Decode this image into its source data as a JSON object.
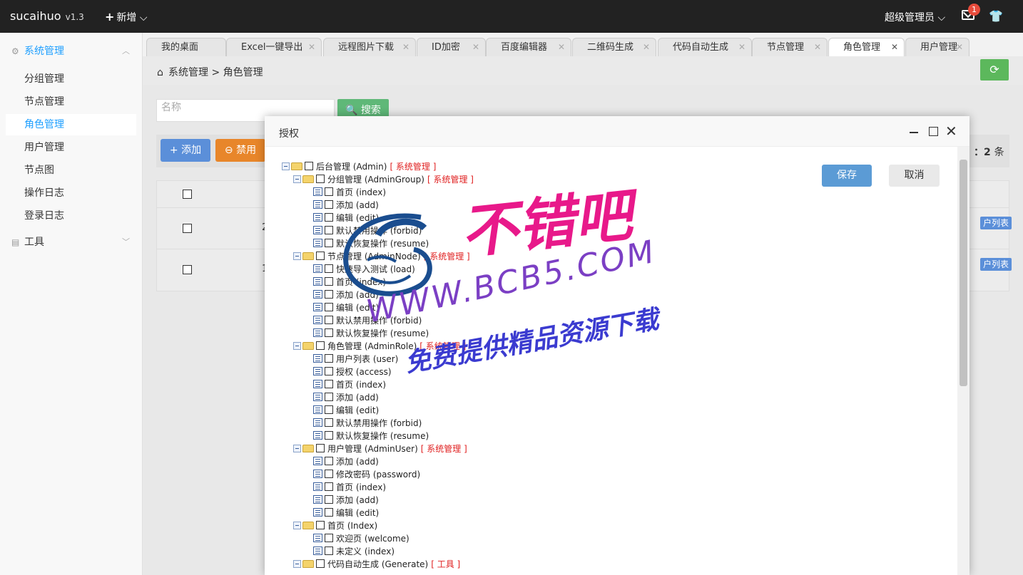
{
  "app": {
    "brand": "sucaihuo",
    "version": "v1.3",
    "new_label": "新增",
    "admin_label": "超级管理员",
    "mail_count": "1"
  },
  "sidebar": {
    "group1": "系统管理",
    "items": [
      "分组管理",
      "节点管理",
      "角色管理",
      "用户管理",
      "节点图",
      "操作日志",
      "登录日志"
    ],
    "active_index": 2,
    "group2": "工具"
  },
  "tabs": [
    {
      "label": "我的桌面",
      "closable": false
    },
    {
      "label": "Excel一键导出",
      "closable": true
    },
    {
      "label": "远程图片下载",
      "closable": true
    },
    {
      "label": "ID加密",
      "closable": true
    },
    {
      "label": "百度编辑器",
      "closable": true
    },
    {
      "label": "二维码生成",
      "closable": true
    },
    {
      "label": "代码自动生成",
      "closable": true
    },
    {
      "label": "节点管理",
      "closable": true
    },
    {
      "label": "角色管理",
      "closable": true,
      "active": true
    },
    {
      "label": "用户管理",
      "closable": true
    }
  ],
  "breadcrumb": {
    "root": "系统管理",
    "sep": ">",
    "current": "角色管理"
  },
  "search": {
    "placeholder": "名称",
    "button": "搜索"
  },
  "toolbar": {
    "add": "添加",
    "ban": "禁用",
    "total_prefix": "：",
    "total_count": "2",
    "total_suffix": "条"
  },
  "table": {
    "rows": [
      {
        "id": "2",
        "action": "户列表"
      },
      {
        "id": "1",
        "action": "户列表"
      }
    ]
  },
  "modal": {
    "title": "授权",
    "save": "保存",
    "cancel": "取消",
    "tree": [
      {
        "level": 0,
        "type": "folder",
        "label": "后台管理 (Admin)",
        "tag": "[ 系统管理 ]"
      },
      {
        "level": 1,
        "type": "folder",
        "label": "分组管理 (AdminGroup)",
        "tag": "[ 系统管理 ]"
      },
      {
        "level": 2,
        "type": "leaf",
        "label": "首页 (index)"
      },
      {
        "level": 2,
        "type": "leaf",
        "label": "添加 (add)"
      },
      {
        "level": 2,
        "type": "leaf",
        "label": "编辑 (edit)"
      },
      {
        "level": 2,
        "type": "leaf",
        "label": "默认禁用操作 (forbid)"
      },
      {
        "level": 2,
        "type": "leaf",
        "label": "默认恢复操作 (resume)"
      },
      {
        "level": 1,
        "type": "folder",
        "label": "节点管理 (AdminNode)",
        "tag": "[ 系统管理 ]"
      },
      {
        "level": 2,
        "type": "leaf",
        "label": "快速导入测试 (load)"
      },
      {
        "level": 2,
        "type": "leaf",
        "label": "首页 (index)"
      },
      {
        "level": 2,
        "type": "leaf",
        "label": "添加 (add)"
      },
      {
        "level": 2,
        "type": "leaf",
        "label": "编辑 (edit)"
      },
      {
        "level": 2,
        "type": "leaf",
        "label": "默认禁用操作 (forbid)"
      },
      {
        "level": 2,
        "type": "leaf",
        "label": "默认恢复操作 (resume)"
      },
      {
        "level": 1,
        "type": "folder",
        "label": "角色管理 (AdminRole)",
        "tag": "[ 系统管理 ]"
      },
      {
        "level": 2,
        "type": "leaf",
        "label": "用户列表 (user)"
      },
      {
        "level": 2,
        "type": "leaf",
        "label": "授权 (access)"
      },
      {
        "level": 2,
        "type": "leaf",
        "label": "首页 (index)"
      },
      {
        "level": 2,
        "type": "leaf",
        "label": "添加 (add)"
      },
      {
        "level": 2,
        "type": "leaf",
        "label": "编辑 (edit)"
      },
      {
        "level": 2,
        "type": "leaf",
        "label": "默认禁用操作 (forbid)"
      },
      {
        "level": 2,
        "type": "leaf",
        "label": "默认恢复操作 (resume)"
      },
      {
        "level": 1,
        "type": "folder",
        "label": "用户管理 (AdminUser)",
        "tag": "[ 系统管理 ]"
      },
      {
        "level": 2,
        "type": "leaf",
        "label": "添加 (add)"
      },
      {
        "level": 2,
        "type": "leaf",
        "label": "修改密码 (password)"
      },
      {
        "level": 2,
        "type": "leaf",
        "label": "首页 (index)"
      },
      {
        "level": 2,
        "type": "leaf",
        "label": "添加 (add)"
      },
      {
        "level": 2,
        "type": "leaf",
        "label": "编辑 (edit)"
      },
      {
        "level": 1,
        "type": "folder",
        "label": "首页 (Index)"
      },
      {
        "level": 2,
        "type": "leaf",
        "label": "欢迎页 (welcome)"
      },
      {
        "level": 2,
        "type": "leaf",
        "label": "未定义 (index)"
      },
      {
        "level": 1,
        "type": "folder",
        "label": "代码自动生成 (Generate)",
        "tag": "[ 工具 ]"
      }
    ]
  },
  "watermark": {
    "big": "不错吧",
    "url": "WWW.BCB5.COM",
    "free": "免费提供精品资源下载"
  },
  "colors": {
    "topbar": "#222222",
    "active": "#1e9fff",
    "tag_red": "#e02020",
    "save_blue": "#5b9bd5"
  }
}
